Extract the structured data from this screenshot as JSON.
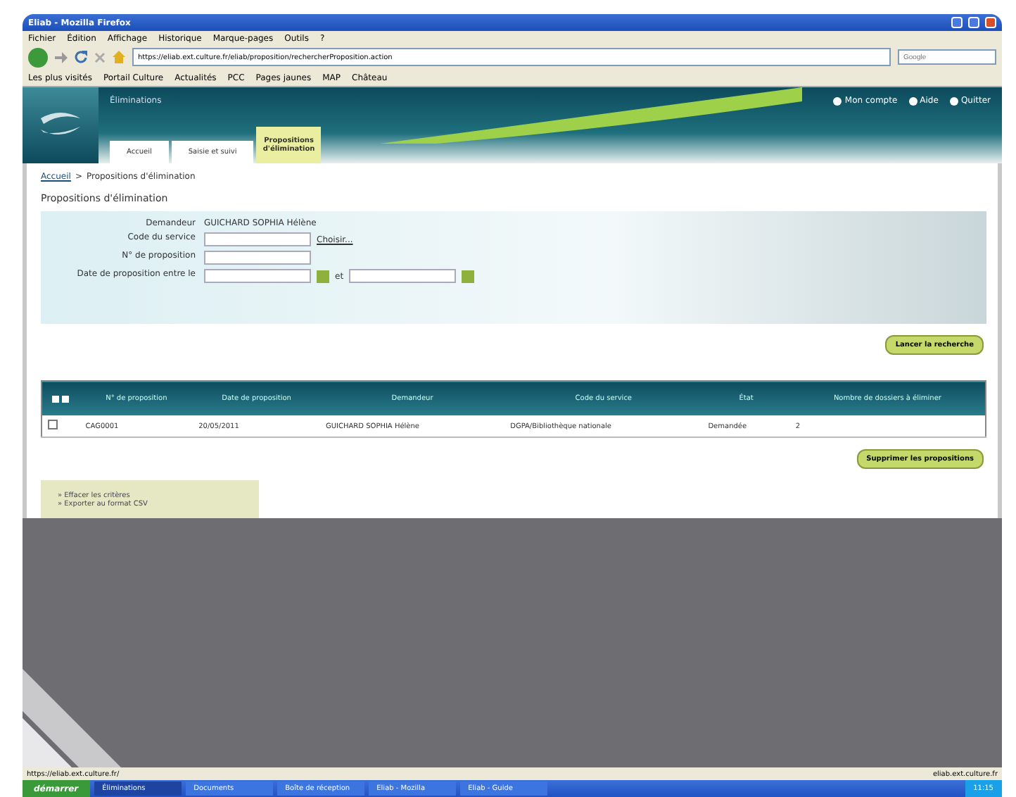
{
  "window": {
    "title": "Eliab - Mozilla Firefox"
  },
  "menu": [
    "Fichier",
    "Édition",
    "Affichage",
    "Historique",
    "Marque-pages",
    "Outils",
    "?"
  ],
  "address": {
    "value": "https://eliab.ext.culture.fr/eliab/proposition/rechercherProposition.action"
  },
  "search": {
    "placeholder": "Google"
  },
  "bookmarks": [
    "Les plus visités",
    "Portail Culture",
    "Actualités",
    "PCC",
    "Pages jaunes",
    "MAP",
    "Château"
  ],
  "app": {
    "title": "Éliminations",
    "links": [
      "Mon compte",
      "Aide",
      "Quitter"
    ],
    "tabs": [
      {
        "label": "Accueil",
        "selected": false
      },
      {
        "label": "Saisie et suivi",
        "selected": false
      },
      {
        "label": "Propositions d'élimination",
        "selected": true
      }
    ]
  },
  "breadcrumb": {
    "items": [
      "Accueil",
      "Propositions d'élimination"
    ],
    "separator": ">"
  },
  "heading": "Propositions d'élimination",
  "form": {
    "fields": [
      {
        "kind": "text",
        "label": "Demandeur",
        "value": "GUICHARD SOPHIA Hélène"
      },
      {
        "kind": "input",
        "label": "Code du service",
        "link": "Choisir..."
      },
      {
        "kind": "input",
        "label": "N° de proposition"
      },
      {
        "kind": "daterange",
        "label": "Date de proposition entre le",
        "joiner": "et"
      }
    ],
    "search_button": "Lancer la recherche"
  },
  "table": {
    "columns": [
      "N° de proposition",
      "Date de proposition",
      "Demandeur",
      "Code du service",
      "État",
      "Nombre de dossiers à éliminer"
    ],
    "rows": [
      {
        "checked": false,
        "cells": [
          "CAG0001",
          "20/05/2011",
          "GUICHARD SOPHIA Hélène",
          "DGPA/Bibliothèque nationale",
          "Demandée",
          "2"
        ]
      }
    ]
  },
  "delete_button": "Supprimer les propositions",
  "actions": [
    "» Effacer les critères",
    "» Exporter au format CSV"
  ],
  "status_bar": {
    "left": "https://eliab.ext.culture.fr/",
    "right": "eliab.ext.culture.fr"
  },
  "taskbar": {
    "start": "démarrer",
    "items": [
      {
        "label": "Éliminations",
        "selected": true
      },
      {
        "label": "Documents",
        "selected": false
      },
      {
        "label": "Boîte de réception",
        "selected": false
      },
      {
        "label": "Eliab - Mozilla",
        "selected": false
      },
      {
        "label": "Eliab - Guide",
        "selected": false
      }
    ],
    "clock": "11:15"
  }
}
